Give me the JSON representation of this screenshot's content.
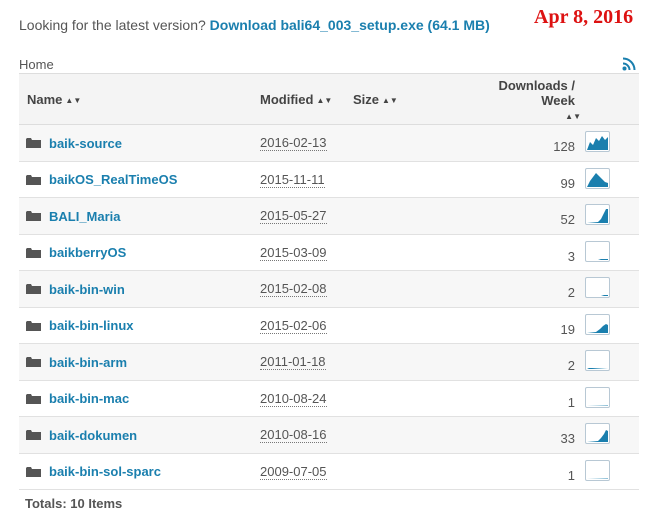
{
  "latest": {
    "prompt": "Looking for the latest version?",
    "link": "Download bali64_003_setup.exe (64.1 MB)"
  },
  "stamp": "Apr 8, 2016",
  "breadcrumb": "Home",
  "columns": {
    "name": "Name",
    "modified": "Modified",
    "size": "Size",
    "downloads": "Downloads / Week"
  },
  "rows": [
    {
      "name": "baik-source",
      "modified": "2016-02-13",
      "size": "",
      "downloads": "128"
    },
    {
      "name": "baikOS_RealTimeOS",
      "modified": "2015-11-11",
      "size": "",
      "downloads": "99"
    },
    {
      "name": "BALI_Maria",
      "modified": "2015-05-27",
      "size": "",
      "downloads": "52"
    },
    {
      "name": "baikberryOS",
      "modified": "2015-03-09",
      "size": "",
      "downloads": "3"
    },
    {
      "name": "baik-bin-win",
      "modified": "2015-02-08",
      "size": "",
      "downloads": "2"
    },
    {
      "name": "baik-bin-linux",
      "modified": "2015-02-06",
      "size": "",
      "downloads": "19"
    },
    {
      "name": "baik-bin-arm",
      "modified": "2011-01-18",
      "size": "",
      "downloads": "2"
    },
    {
      "name": "baik-bin-mac",
      "modified": "2010-08-24",
      "size": "",
      "downloads": "1"
    },
    {
      "name": "baik-dokumen",
      "modified": "2010-08-16",
      "size": "",
      "downloads": "33"
    },
    {
      "name": "baik-bin-sol-sparc",
      "modified": "2009-07-05",
      "size": "",
      "downloads": "1"
    }
  ],
  "totals": "Totals: 10 Items",
  "colors": {
    "link": "#1a7fae",
    "stamp": "#dd1111",
    "spark": "#1a7fae"
  },
  "icons": {
    "folder": "folder-icon",
    "rss": "rss-feed-icon",
    "sort": "sort-arrows-icon",
    "sparkline": "sparkline-chart"
  }
}
